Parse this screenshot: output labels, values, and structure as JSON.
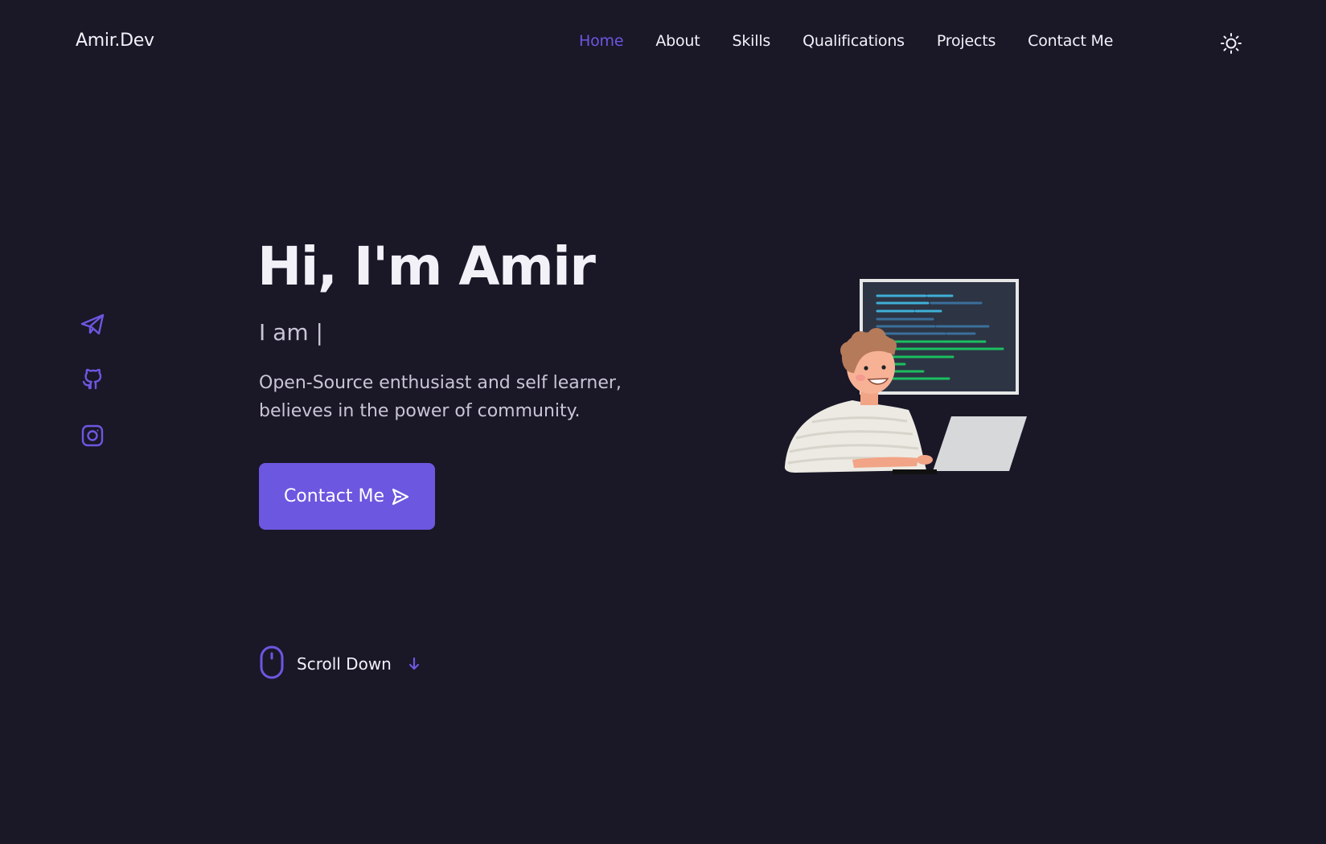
{
  "header": {
    "logo": "Amir.Dev",
    "nav": [
      {
        "label": "Home",
        "active": true
      },
      {
        "label": "About",
        "active": false
      },
      {
        "label": "Skills",
        "active": false
      },
      {
        "label": "Qualifications",
        "active": false
      },
      {
        "label": "Projects",
        "active": false
      },
      {
        "label": "Contact Me",
        "active": false
      }
    ],
    "theme_toggle_icon": "sun-icon"
  },
  "social": [
    {
      "icon": "telegram-icon"
    },
    {
      "icon": "github-icon"
    },
    {
      "icon": "instagram-icon"
    }
  ],
  "hero": {
    "title": "Hi, I'm Amir",
    "subtitle": "I am |",
    "description_line1": "Open-Source enthusiast and self learner,",
    "description_line2": "believes in the power of community.",
    "cta_label": "Contact Me",
    "cta_icon": "send-icon",
    "illustration": "developer-at-laptop-illustration"
  },
  "scroll": {
    "label": "Scroll Down",
    "mouse_icon": "mouse-icon",
    "arrow_icon": "arrow-down-icon"
  },
  "colors": {
    "background": "#1a1727",
    "accent": "#6c57e0",
    "text": "#f3f1f8",
    "text_muted": "#c9c5d6"
  }
}
